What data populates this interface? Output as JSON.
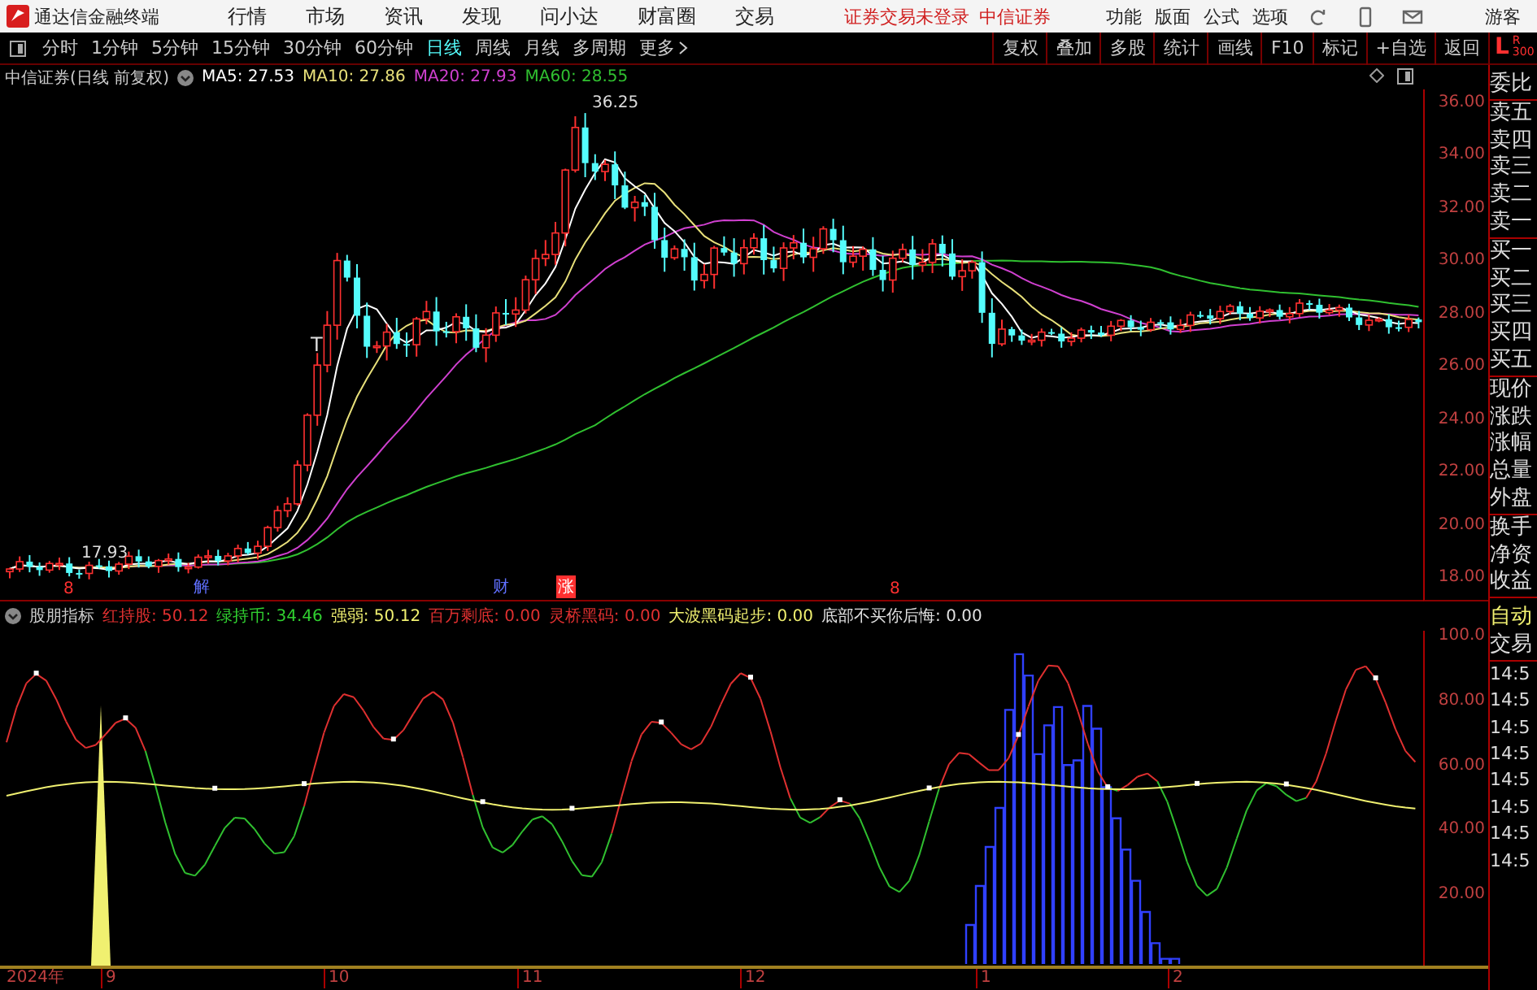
{
  "menubar": {
    "app_title": "通达信金融终端",
    "menus": [
      "行情",
      "市场",
      "资讯",
      "发现",
      "问小达",
      "财富圈",
      "交易"
    ],
    "login_status": "证券交易未登录",
    "broker": "中信证券",
    "tools": [
      "功能",
      "版面",
      "公式",
      "选项"
    ],
    "user": "游客"
  },
  "periods": [
    {
      "label": "分时",
      "selected": false
    },
    {
      "label": "1分钟",
      "selected": false
    },
    {
      "label": "5分钟",
      "selected": false
    },
    {
      "label": "15分钟",
      "selected": false
    },
    {
      "label": "30分钟",
      "selected": false
    },
    {
      "label": "60分钟",
      "selected": false
    },
    {
      "label": "日线",
      "selected": true
    },
    {
      "label": "周线",
      "selected": false
    },
    {
      "label": "月线",
      "selected": false
    },
    {
      "label": "多周期",
      "selected": false
    },
    {
      "label": "更多",
      "selected": false
    }
  ],
  "tool_buttons": [
    "复权",
    "叠加",
    "多股",
    "统计",
    "画线",
    "F10",
    "标记",
    "+自选",
    "返回"
  ],
  "chart_info": {
    "title": "中信证券(日线 前复权)",
    "ma": [
      {
        "label": "MA5: 27.53",
        "color": "#ffffff"
      },
      {
        "label": "MA10: 27.86",
        "color": "#e8e07a"
      },
      {
        "label": "MA20: 27.93",
        "color": "#d040d0"
      },
      {
        "label": "MA60: 28.55",
        "color": "#30c030"
      }
    ]
  },
  "price_axis": [
    "36.00",
    "34.00",
    "32.00",
    "30.00",
    "28.00",
    "26.00",
    "24.00",
    "22.00",
    "20.00",
    "18.00"
  ],
  "price_labels": {
    "high": "36.25",
    "low": "17.93",
    "signal": "T"
  },
  "event_markers": [
    {
      "label": "8",
      "color": "#ff3030"
    },
    {
      "label": "解",
      "color": "#6070ff"
    },
    {
      "label": "财",
      "color": "#6070ff"
    },
    {
      "label": "涨",
      "color": "#ff3030"
    },
    {
      "label": "8",
      "color": "#ff3030"
    }
  ],
  "indicator": {
    "name": "股朋指标",
    "values": [
      {
        "label": "红持股: 50.12",
        "color": "#e03030"
      },
      {
        "label": "绿持币: 34.46",
        "color": "#30d030"
      },
      {
        "label": "强弱: 50.12",
        "color": "#f0f070"
      },
      {
        "label": "百万剩底: 0.00",
        "color": "#e03030"
      },
      {
        "label": "灵桥黑码: 0.00",
        "color": "#e03030"
      },
      {
        "label": "大波黑码起步: 0.00",
        "color": "#f0f070"
      },
      {
        "label": "底部不买你后悔: 0.00",
        "color": "#e0e0e0"
      }
    ]
  },
  "indicator_axis": [
    "100.0",
    "80.00",
    "60.00",
    "40.00",
    "20.00"
  ],
  "time_axis": [
    "2024年",
    "9",
    "10",
    "11",
    "12",
    "1",
    "2"
  ],
  "side_panel": {
    "corner": {
      "main": "L",
      "sub": "R",
      "count": "300"
    },
    "quote_labels": [
      "委比",
      "卖五",
      "卖四",
      "卖三",
      "卖二",
      "卖一",
      "买一",
      "买二",
      "买三",
      "买四",
      "买五",
      "现价",
      "涨跌",
      "涨幅",
      "总量",
      "外盘",
      "换手",
      "净资",
      "收益"
    ],
    "trade": [
      "自动",
      "交易"
    ],
    "ticks": [
      "14:5",
      "14:5",
      "14:5",
      "14:5",
      "14:5",
      "14:5",
      "14:5",
      "14:5"
    ]
  }
}
